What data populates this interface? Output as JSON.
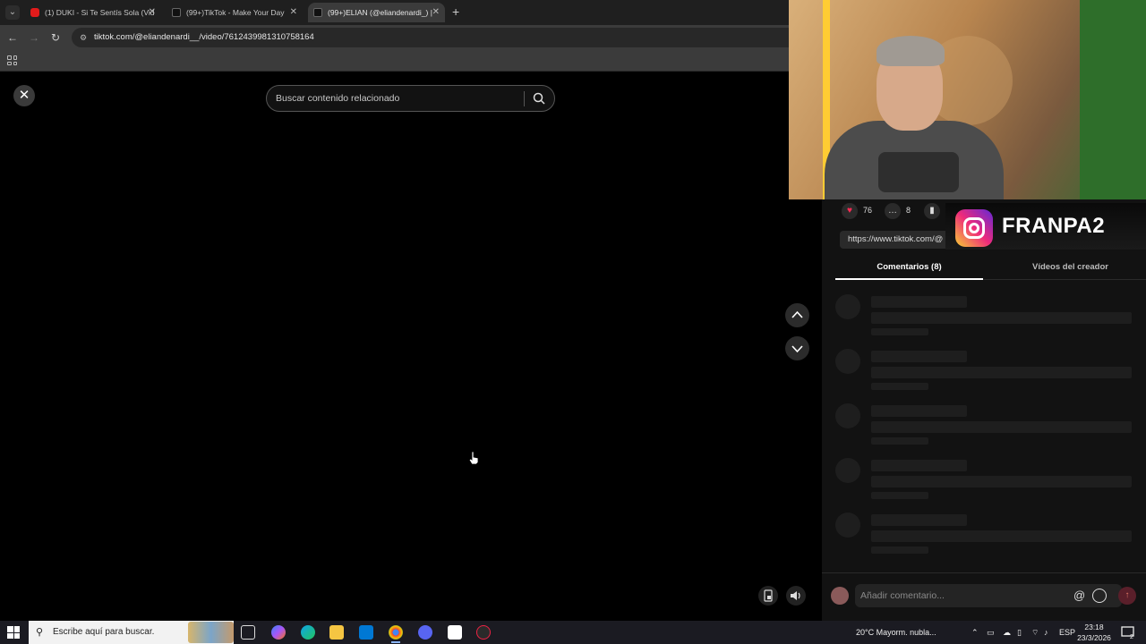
{
  "browser": {
    "tabs": [
      {
        "title": "(1) DUKI - Si Te Sentís Sola (Vid",
        "favicon": "youtube-icon",
        "active": false
      },
      {
        "title": "(99+)TikTok - Make Your Day",
        "favicon": "tiktok-icon",
        "active": false
      },
      {
        "title": "(99+)ELIAN (@eliandenardi_) |",
        "favicon": "tiktok-icon",
        "active": true
      }
    ],
    "url": "tiktok.com/@eliandenardi__/video/7612439981310758164"
  },
  "viewer": {
    "search_placeholder": "Buscar contenido relacionado"
  },
  "panel": {
    "likes": "76",
    "comments": "8",
    "link": "https://www.tiktok.com/@",
    "tabs": [
      "Comentarios (8)",
      "Vídeos del creador"
    ],
    "comment_placeholder": "Añadir comentario...",
    "skeleton_rows": 5
  },
  "overlay": {
    "instagram_handle": "FRANPA2"
  },
  "taskbar": {
    "search_placeholder": "Escribe aquí para buscar.",
    "weather": "20°C  Mayorm. nubla...",
    "language": "ESP",
    "time": "23:18",
    "date": "23/3/2026",
    "notifications": "2"
  },
  "colors": {
    "accent_like": "#fe2c55",
    "background": "#121212",
    "viewer_bg": "#000000"
  }
}
